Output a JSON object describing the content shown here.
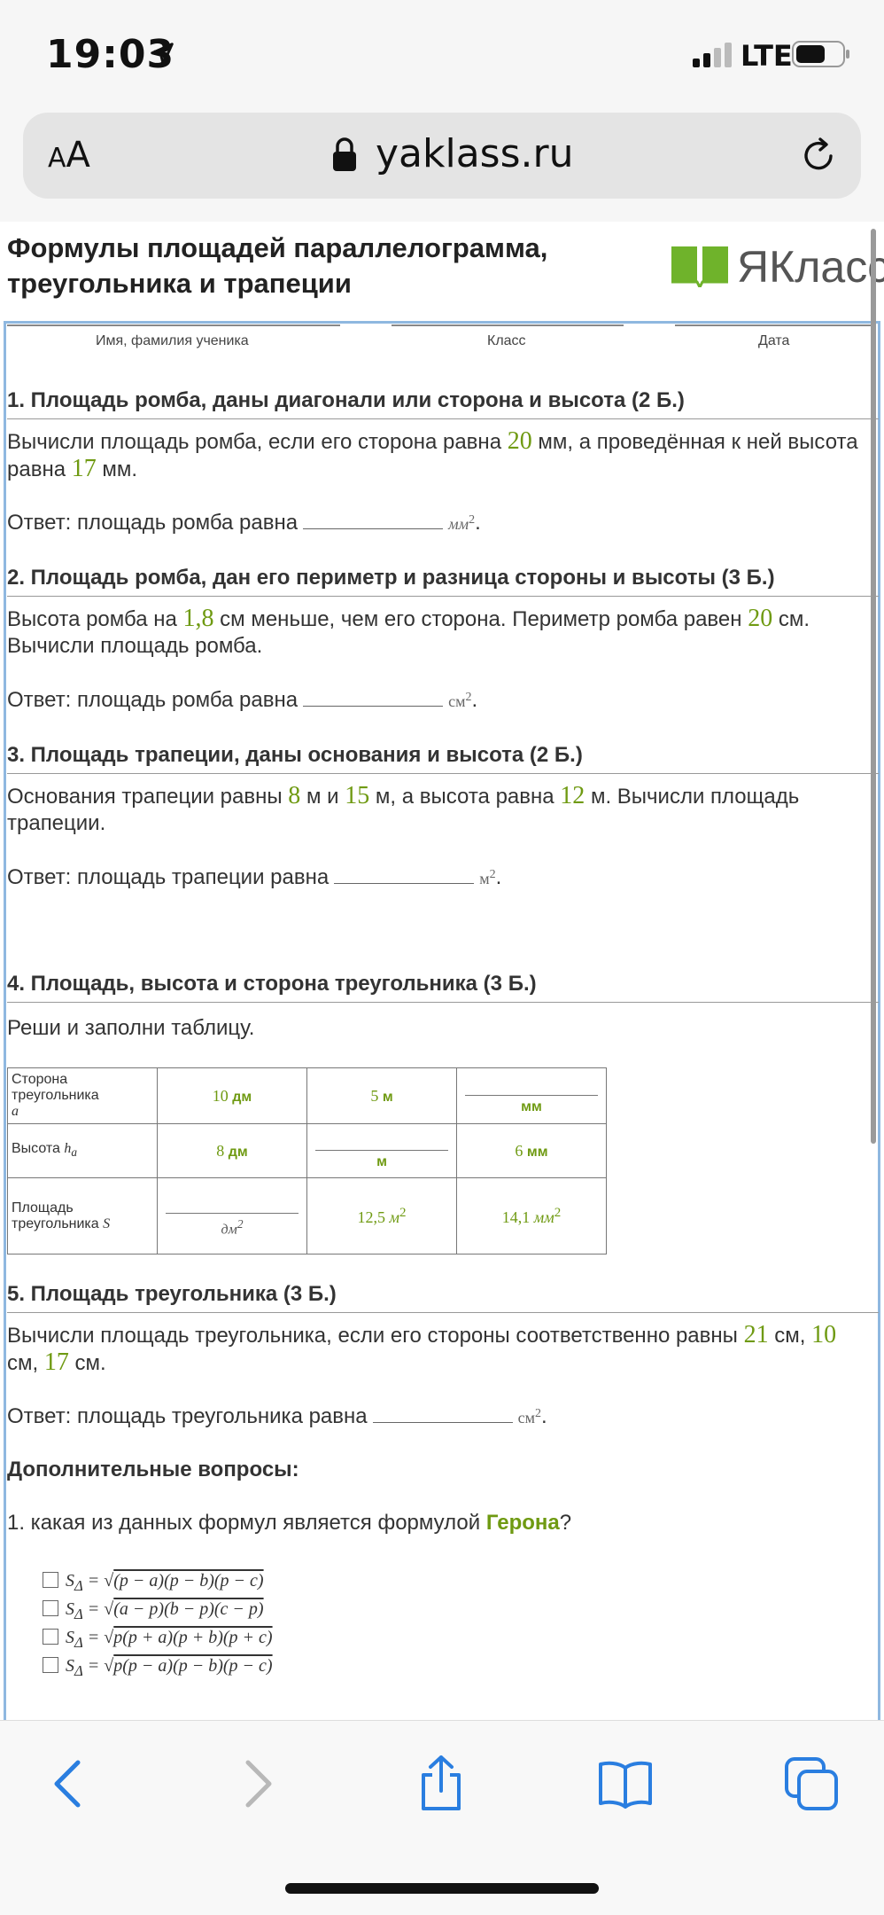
{
  "status": {
    "time": "19:03",
    "network": "LTE"
  },
  "browser": {
    "aa_small": "A",
    "aa_big": "A",
    "domain": "yaklass.ru"
  },
  "page": {
    "title": "Формулы площадей параллелограмма, треугольника и трапеции",
    "logo": "ЯКласс",
    "header_fields": [
      "Имя, фамилия ученика",
      "Класс",
      "Дата"
    ]
  },
  "tasks": [
    {
      "title": "1.  Площадь ромба, даны диагонали или сторона и высота  (2 Б.)",
      "text_parts": [
        "Вычисли площадь ромба, если его сторона равна ",
        "20",
        " мм, а проведённая к ней высота равна ",
        "17",
        " мм."
      ],
      "answer_label": "Ответ: площадь ромба равна",
      "answer_unit": "мм"
    },
    {
      "title": "2.  Площадь ромба, дан его периметр и разница стороны и высоты  (3 Б.)",
      "text_parts": [
        "Высота ромба на ",
        "1,8",
        " см меньше, чем его сторона. Периметр ромба равен ",
        "20",
        " см. Вычисли площадь ромба."
      ],
      "answer_label": "Ответ: площадь ромба равна",
      "answer_unit": "см"
    },
    {
      "title": "3.  Площадь трапеции, даны основания и высота  (2 Б.)",
      "text_parts": [
        "Основания трапеции равны ",
        "8",
        " м и ",
        "15",
        " м, а высота равна ",
        "12",
        " м. Вычисли площадь трапеции."
      ],
      "answer_label": "Ответ: площадь трапеции равна",
      "answer_unit": "м"
    },
    {
      "title": "4.  Площадь, высота и сторона треугольника  (3 Б.)",
      "instruction": "Реши и заполни таблицу."
    },
    {
      "title": "5.  Площадь треугольника  (3 Б.)",
      "text_parts": [
        "Вычисли площадь треугольника, если его стороны соответственно равны ",
        "21",
        " см, ",
        "10",
        " см, ",
        "17",
        " см."
      ],
      "answer_label": "Ответ: площадь треугольника равна",
      "answer_unit": "см"
    }
  ],
  "table": {
    "row1_label": "Сторона треугольника",
    "row1_var": "a",
    "row2_label": "Высота",
    "row2_var": "h",
    "row2_sub": "a",
    "row3_label": "Площадь треугольника",
    "row3_var": "S",
    "r1c1": "10",
    "r1c1_unit": "дм",
    "r1c2": "5",
    "r1c2_unit": "м",
    "r1c3_unit": "мм",
    "r2c1": "8",
    "r2c1_unit": "дм",
    "r2c2_unit": "м",
    "r2c3": "6",
    "r2c3_unit": "мм",
    "r3c1_unit": "дм",
    "r3c2": "12,5",
    "r3c2_unit": "м",
    "r3c3": "14,1",
    "r3c3_unit": "мм"
  },
  "extra": {
    "title": "Дополнительные вопросы:",
    "q1_before": "1. какая из данных формул является формулой ",
    "q1_name": "Герона",
    "q1_after": "?",
    "options": [
      {
        "lhs": "S",
        "sub": "Δ",
        "eq": " = √",
        "expr": "(p − a)(p − b)(p − c)"
      },
      {
        "lhs": "S",
        "sub": "Δ",
        "eq": " = √",
        "expr": "(a − p)(b − p)(c − p)"
      },
      {
        "lhs": "S",
        "sub": "Δ",
        "eq": " = √",
        "expr": "p(p + a)(p + b)(p + c)"
      },
      {
        "lhs": "S",
        "sub": "Δ",
        "eq": " = √",
        "expr": "p(p − a)(p − b)(p − c)"
      }
    ]
  },
  "sup2": "2",
  "colors": {
    "accent_green": "#6f9a12",
    "ios_blue": "#2a7ee0",
    "frame_blue": "#8fb8e0"
  }
}
